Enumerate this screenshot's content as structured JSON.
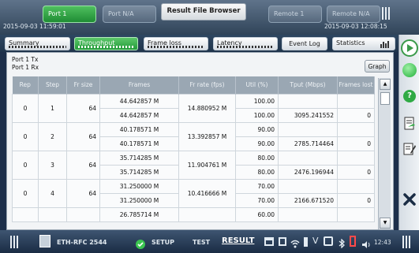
{
  "ports": [
    {
      "label": "Port 1",
      "active": true
    },
    {
      "label": "Port N/A",
      "active": false
    },
    {
      "label": "Remote 1",
      "active": false
    },
    {
      "label": "Remote N/A",
      "active": false
    }
  ],
  "window_title": "Result File Browser",
  "timestamps": {
    "left": "2015-09-03 11:59:01",
    "right": "2015-09-03 12:08:15"
  },
  "tabs": [
    {
      "label": "Summary",
      "active": false
    },
    {
      "label": "Throughput",
      "active": true
    },
    {
      "label": "Frame loss",
      "active": false
    },
    {
      "label": "Latency",
      "active": false
    },
    {
      "label": "Event Log",
      "active": false
    },
    {
      "label": "Statistics",
      "active": false
    }
  ],
  "port_labels": {
    "tx": "Port 1 Tx",
    "rx": "Port 1 Rx"
  },
  "graph_button": "Graph",
  "table": {
    "headers": [
      "Rep",
      "Step",
      "Fr size",
      "Frames",
      "Fr rate (fps)",
      "Util (%)",
      "Tput (Mbps)",
      "Frames lost"
    ],
    "groups": [
      {
        "rep": "0",
        "step": "1",
        "size": "64",
        "frames": [
          "44.642857 M",
          "44.642857 M"
        ],
        "rate": "14.880952 M",
        "util": [
          "100.00",
          "100.00"
        ],
        "tput": "3095.241552",
        "lost": "0"
      },
      {
        "rep": "0",
        "step": "2",
        "size": "64",
        "frames": [
          "40.178571 M",
          "40.178571 M"
        ],
        "rate": "13.392857 M",
        "util": [
          "90.00",
          "90.00"
        ],
        "tput": "2785.714464",
        "lost": "0"
      },
      {
        "rep": "0",
        "step": "3",
        "size": "64",
        "frames": [
          "35.714285 M",
          "35.714285 M"
        ],
        "rate": "11.904761 M",
        "util": [
          "80.00",
          "80.00"
        ],
        "tput": "2476.196944",
        "lost": "0"
      },
      {
        "rep": "0",
        "step": "4",
        "size": "64",
        "frames": [
          "31.250000 M",
          "31.250000 M"
        ],
        "rate": "10.416666 M",
        "util": [
          "70.00",
          "70.00"
        ],
        "tput": "2166.671520",
        "lost": "0"
      }
    ],
    "partial_row": {
      "frames": "26.785714 M",
      "util": "60.00"
    }
  },
  "bottom": {
    "test_name": "ETH-RFC 2544",
    "setup": "SETUP",
    "test": "TEST",
    "result": "RESULT",
    "clock": "12:43",
    "battery": "V"
  },
  "icons": [
    "play-icon",
    "status-led-icon",
    "help-icon",
    "clipboard-icon",
    "edit-report-icon",
    "close-icon",
    "menu-grip-icon",
    "test-app-icon",
    "check-circle-icon",
    "network-icon",
    "screen-icon",
    "wifi-icon",
    "usb-icon",
    "battery-icon",
    "camera-icon",
    "bluetooth-icon",
    "usb-flash-icon",
    "speaker-icon"
  ],
  "colors": {
    "active_green": "#2aa43e",
    "header_bg": "#9aa7b3",
    "frame_bg": "#1d2f4a",
    "close_x": "#1a2c44"
  }
}
